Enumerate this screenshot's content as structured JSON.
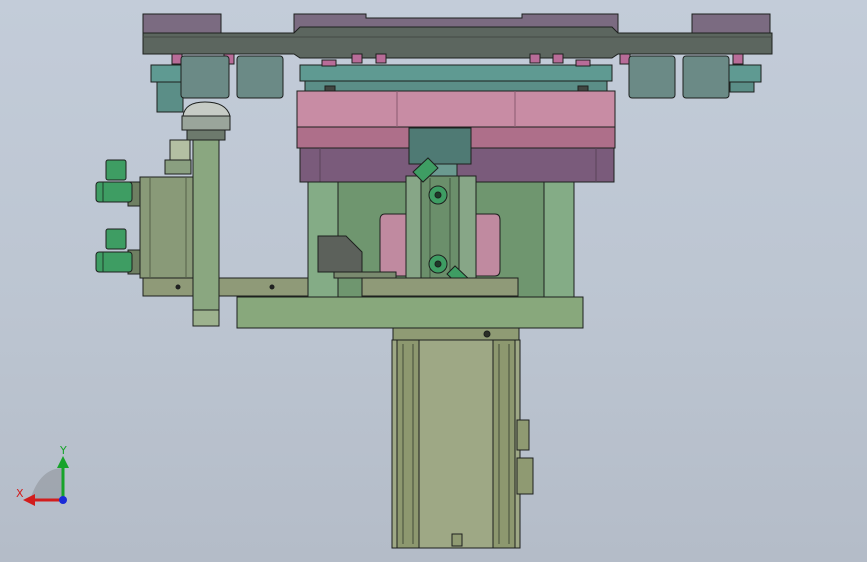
{
  "viewport": {
    "background_top": "#c3ccd9",
    "background_bottom": "#b4bcc8"
  },
  "triad": {
    "x_label": "X",
    "y_label": "Y",
    "x_color": "#d21d1d",
    "y_color": "#17a32a",
    "z_color": "#1a2bd8"
  },
  "colors": {
    "plate_dark": "#5f6a64",
    "plate_purple": "#86698b",
    "rotor_pink": "#b87d93",
    "cylinder_teal": "#5f8d86",
    "frame_green": "#7fa57c",
    "bracket_olive": "#8a9c74",
    "motor_olive": "#929c77",
    "fitting_green": "#3b9c63"
  }
}
